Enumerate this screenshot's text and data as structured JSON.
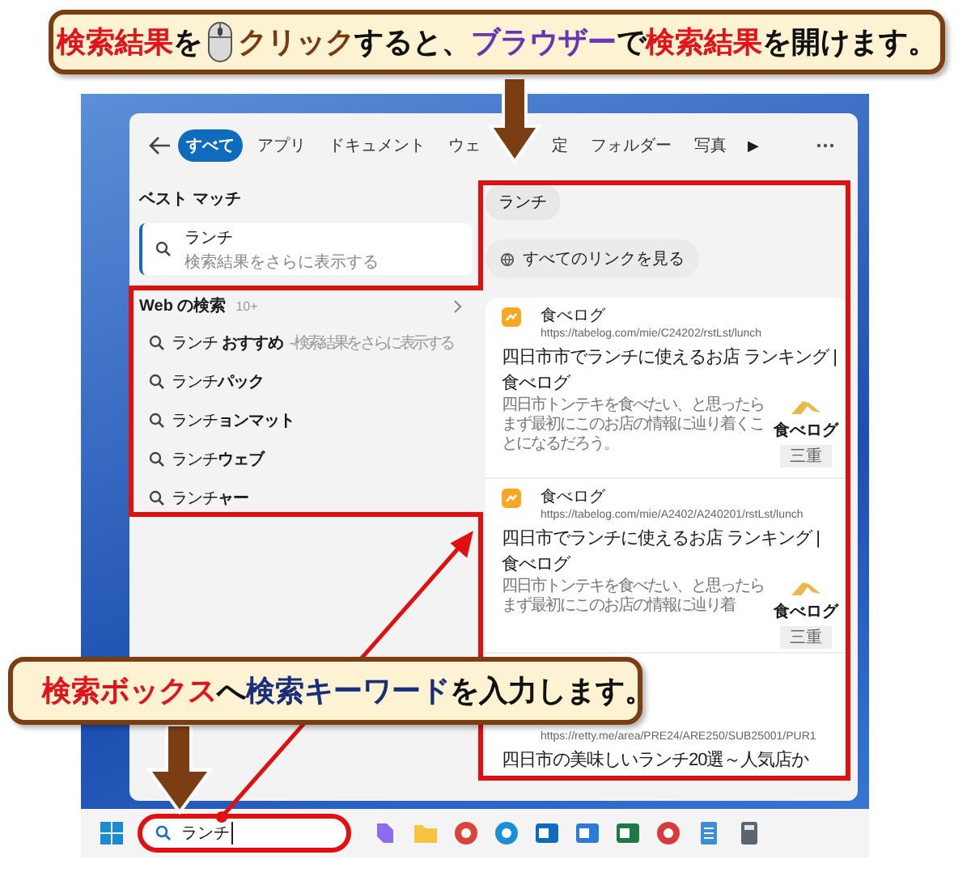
{
  "callouts": [
    {
      "parts": [
        {
          "kind": "text",
          "runs": [
            {
              "text": "検索結果",
              "color": "#e0141a"
            },
            {
              "text": "を",
              "color": "#111111"
            }
          ]
        },
        {
          "kind": "mouse"
        },
        {
          "kind": "text",
          "runs": [
            {
              "text": "クリック",
              "color": "#7a3a10"
            },
            {
              "text": "すると、",
              "color": "#111111"
            },
            {
              "text": "ブラウザー",
              "color": "#6a35b0"
            },
            {
              "text": "で",
              "color": "#111111"
            },
            {
              "text": "検索結果",
              "color": "#e0141a"
            },
            {
              "text": "を開けます。",
              "color": "#111111"
            }
          ]
        }
      ]
    },
    {
      "parts": [
        {
          "kind": "text",
          "runs": [
            {
              "text": "検索ボックス",
              "color": "#e0141a"
            },
            {
              "text": "へ",
              "color": "#111111"
            },
            {
              "text": "検索キーワード",
              "color": "#1a2f7a"
            },
            {
              "text": "を入力します。",
              "color": "#111111"
            }
          ]
        }
      ]
    }
  ],
  "search_panel": {
    "tabs": [
      {
        "label": "すべて",
        "selected": true
      },
      {
        "label": "アプリ",
        "selected": false
      },
      {
        "label": "ドキュメント",
        "selected": false
      },
      {
        "label": "ウェ",
        "selected": false
      },
      {
        "label": "定",
        "selected": false
      },
      {
        "label": "フォルダー",
        "selected": false
      },
      {
        "label": "写真",
        "selected": false
      }
    ],
    "more_tabs": "▶",
    "best_match": {
      "heading": "ベスト マッチ",
      "item": {
        "title": "ランチ",
        "subtitle": "検索結果をさらに表示する",
        "selected": true
      }
    },
    "web": {
      "heading": "Web の検索",
      "count": "10+",
      "suggestions": [
        {
          "text": "ランチ **おすすめ**",
          "hint": "- 検索結果をさらに表示する"
        },
        {
          "text": "ランチ**パック**"
        },
        {
          "text": "ランチ**ョンマット**"
        },
        {
          "text": "ランチ**ウェブ**"
        },
        {
          "text": "ランチ**ャー**"
        }
      ]
    },
    "preview": {
      "chip": "ランチ",
      "all_links": "すべてのリンクを見る",
      "results": [
        {
          "site": "食べログ",
          "url": "https://tabelog.com/mie/C24202/rstLst/lunch",
          "title": "四日市市でランチに使えるお店 ランキング | 食べログ",
          "snippet": "四日市トンテキを食べたい、と思ったらまず最初にこのお店の情報に辿り着くことになるだろう。",
          "thumb": {
            "label": "食べログ",
            "tag": "三重"
          }
        },
        {
          "site": "食べログ",
          "url": "https://tabelog.com/mie/A2402/A240201/rstLst/lunch",
          "title": "四日市でランチに使えるお店 ランキング | 食べログ",
          "snippet": "四日市トンテキを食べたい、と思ったらまず最初にこのお店の情報に辿り着",
          "thumb": {
            "label": "食べログ",
            "tag": "三重"
          }
        },
        {
          "url": "https://retty.me/area/PRE24/ARE250/SUB25001/PUR1",
          "title": "四日市の美味しいランチ20選～人気店か"
        }
      ]
    }
  },
  "taskbar": {
    "search_value": "ランチ"
  }
}
